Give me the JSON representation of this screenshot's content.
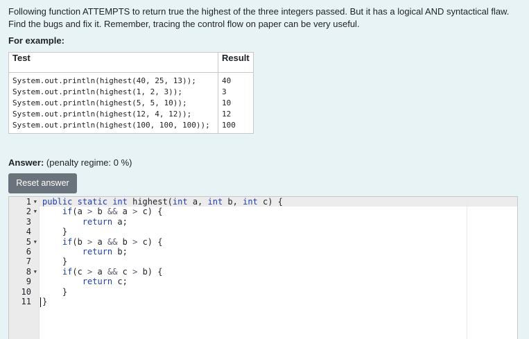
{
  "question": {
    "text": "Following function ATTEMPTS to return true the highest of the three integers passed. But it has a logical AND syntactical flaw. Find the bugs and fix it. Remember, tracing the control flow on paper can be very useful.",
    "for_example": "For example:"
  },
  "examples_table": {
    "headers": [
      "Test",
      "Result"
    ],
    "rows": [
      {
        "test": "System.out.println(highest(40, 25, 13));",
        "result": "40"
      },
      {
        "test": "System.out.println(highest(1, 2, 3));",
        "result": "3"
      },
      {
        "test": "System.out.println(highest(5, 5, 10));",
        "result": "10"
      },
      {
        "test": "System.out.println(highest(12, 4, 12));",
        "result": "12"
      },
      {
        "test": "System.out.println(highest(100, 100, 100));",
        "result": "100"
      }
    ]
  },
  "answer": {
    "label": "Answer:",
    "penalty": "(penalty regime: 0 %)",
    "reset_label": "Reset answer"
  },
  "editor": {
    "line_numbers": [
      "1",
      "2",
      "3",
      "4",
      "5",
      "6",
      "7",
      "8",
      "9",
      "10",
      "11"
    ],
    "fold_markers": [
      "1",
      "2",
      "5",
      "8"
    ],
    "lines": [
      [
        [
          "kw",
          "public"
        ],
        [
          "id",
          " "
        ],
        [
          "kw",
          "static"
        ],
        [
          "id",
          " "
        ],
        [
          "kw",
          "int"
        ],
        [
          "id",
          " highest("
        ],
        [
          "kw",
          "int"
        ],
        [
          "id",
          " a, "
        ],
        [
          "kw",
          "int"
        ],
        [
          "id",
          " b, "
        ],
        [
          "kw",
          "int"
        ],
        [
          "id",
          " c) {"
        ]
      ],
      [
        [
          "id",
          "    "
        ],
        [
          "kw",
          "if"
        ],
        [
          "id",
          "(a "
        ],
        [
          "op",
          ">"
        ],
        [
          "id",
          " b "
        ],
        [
          "op",
          "&&"
        ],
        [
          "id",
          " a "
        ],
        [
          "op",
          ">"
        ],
        [
          "id",
          " c) {"
        ]
      ],
      [
        [
          "id",
          "        "
        ],
        [
          "kw",
          "return"
        ],
        [
          "id",
          " a;"
        ]
      ],
      [
        [
          "id",
          "    }"
        ]
      ],
      [
        [
          "id",
          "    "
        ],
        [
          "kw",
          "if"
        ],
        [
          "id",
          "(b "
        ],
        [
          "op",
          ">"
        ],
        [
          "id",
          " a "
        ],
        [
          "op",
          "&&"
        ],
        [
          "id",
          " b "
        ],
        [
          "op",
          ">"
        ],
        [
          "id",
          " c) {"
        ]
      ],
      [
        [
          "id",
          "        "
        ],
        [
          "kw",
          "return"
        ],
        [
          "id",
          " b;"
        ]
      ],
      [
        [
          "id",
          "    }"
        ]
      ],
      [
        [
          "id",
          "    "
        ],
        [
          "kw",
          "if"
        ],
        [
          "id",
          "(c "
        ],
        [
          "op",
          ">"
        ],
        [
          "id",
          " a "
        ],
        [
          "op",
          "&&"
        ],
        [
          "id",
          " c "
        ],
        [
          "op",
          ">"
        ],
        [
          "id",
          " b) {"
        ]
      ],
      [
        [
          "id",
          "        "
        ],
        [
          "kw",
          "return"
        ],
        [
          "id",
          " c;"
        ]
      ],
      [
        [
          "id",
          "    }"
        ]
      ],
      [
        [
          "id",
          "}"
        ]
      ]
    ]
  }
}
